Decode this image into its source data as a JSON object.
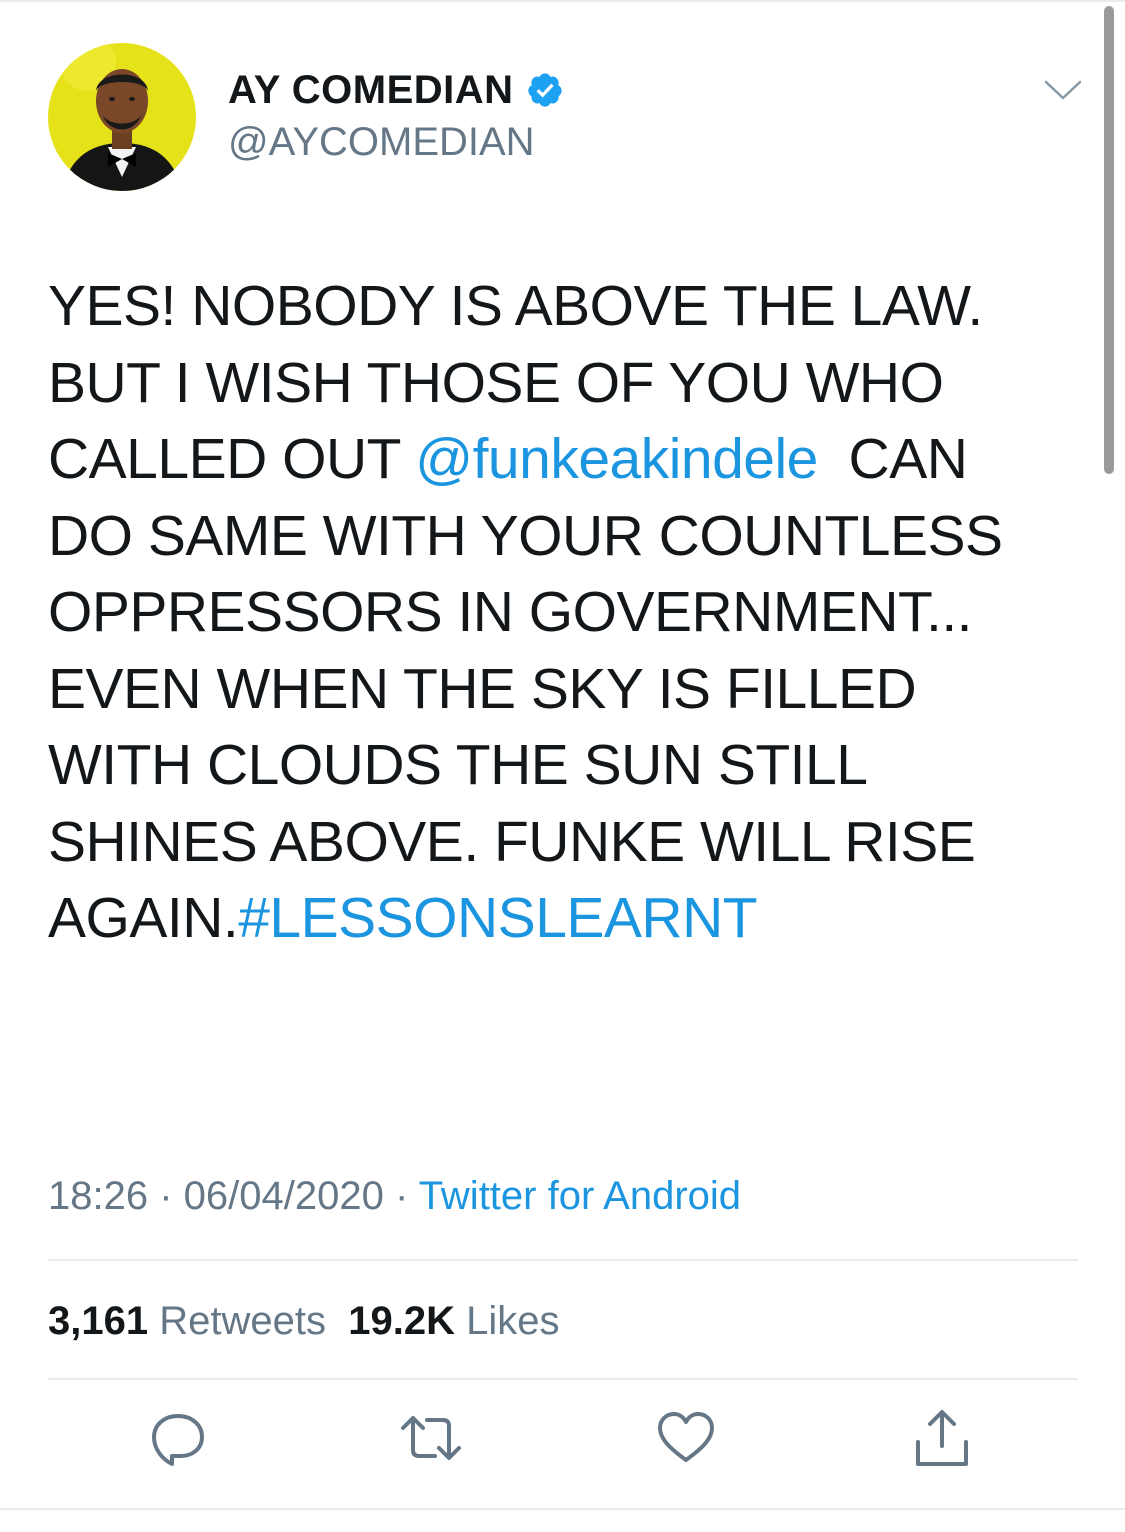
{
  "user": {
    "display_name": "AY COMEDIAN",
    "handle": "@AYCOMEDIAN",
    "verified": true
  },
  "tweet": {
    "lines": [
      [
        {
          "text": "YES! NOBODY IS ABOVE THE LAW."
        }
      ],
      [
        {
          "text": "BUT I WISH THOSE OF YOU WHO"
        }
      ],
      [
        {
          "text": "CALLED OUT "
        },
        {
          "text": "@funkeakindele",
          "link": true
        },
        {
          "text": "  CAN"
        }
      ],
      [
        {
          "text": "DO SAME WITH YOUR COUNTLESS"
        }
      ],
      [
        {
          "text": "OPPRESSORS IN GOVERNMENT..."
        }
      ],
      [
        {
          "text": "EVEN WHEN THE SKY IS FILLED"
        }
      ],
      [
        {
          "text": "WITH CLOUDS THE SUN STILL"
        }
      ],
      [
        {
          "text": "SHINES ABOVE. FUNKE WILL RISE"
        }
      ],
      [
        {
          "text": "AGAIN."
        },
        {
          "text": "#LESSONSLEARNT",
          "link": true
        }
      ]
    ]
  },
  "meta": {
    "time": "18:26",
    "separator": " · ",
    "date": "06/04/2020",
    "source": "Twitter for Android"
  },
  "stats": {
    "retweets_count": "3,161",
    "retweets_label": "Retweets",
    "likes_count": "19.2K",
    "likes_label": "Likes"
  },
  "actions": {
    "reply_icon": "reply-icon",
    "retweet_icon": "retweet-icon",
    "like_icon": "heart-icon",
    "share_icon": "share-icon"
  },
  "colors": {
    "link": "#1b95e0",
    "muted": "#657786",
    "text": "#14171a",
    "divider": "#e6ecf0",
    "avatar_bg": "#e6e21a"
  }
}
